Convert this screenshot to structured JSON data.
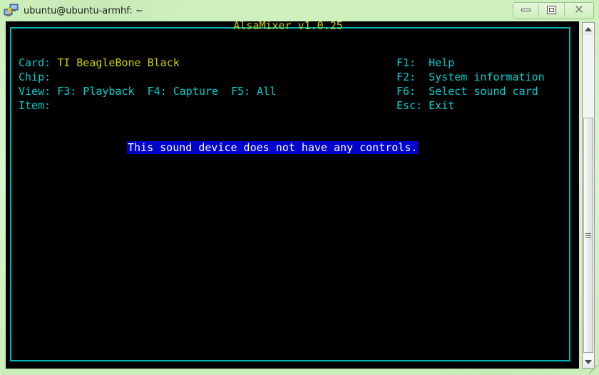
{
  "window": {
    "title": "ubuntu@ubuntu-armhf: ~",
    "icon": "terminal-computer-icon",
    "buttons": {
      "minimize": "minimize-icon",
      "maximize": "maximize-icon",
      "close": "✕"
    },
    "frame_color": "#d2f2c3"
  },
  "terminal": {
    "background": "#000000",
    "border_color": "#00b3b3",
    "colors": {
      "cyan": "#00cdcd",
      "yellow": "#cdcd00",
      "white": "#ffffff",
      "highlight_bg": "#0000cd"
    },
    "box_title": "AlsaMixer v1.0.25",
    "info": {
      "card_label": "Card:",
      "card_value": "TI BeagleBone Black",
      "chip_label": "Chip:",
      "chip_value": "",
      "view_label": "View:",
      "view_value": "F3: Playback  F4: Capture  F5: All",
      "item_label": "Item:",
      "item_value": ""
    },
    "help": [
      {
        "key": "F1:",
        "action": "Help"
      },
      {
        "key": "F2:",
        "action": "System information"
      },
      {
        "key": "F6:",
        "action": "Select sound card"
      },
      {
        "key": "Esc:",
        "action": "Exit"
      }
    ],
    "help_lines": [
      "F1:  Help",
      "F2:  System information",
      "F6:  Select sound card",
      "Esc: Exit"
    ],
    "message": "This sound device does not have any controls.",
    "info_lines": [
      "Card: TI BeagleBone Black",
      "Chip:",
      "View: F3: Playback  F4: Capture  F5: All",
      "Item:"
    ]
  },
  "scrollbar": {
    "up_arrow": "scroll-up-icon",
    "down_arrow": "scroll-down-icon",
    "thumb": "scroll-thumb"
  }
}
